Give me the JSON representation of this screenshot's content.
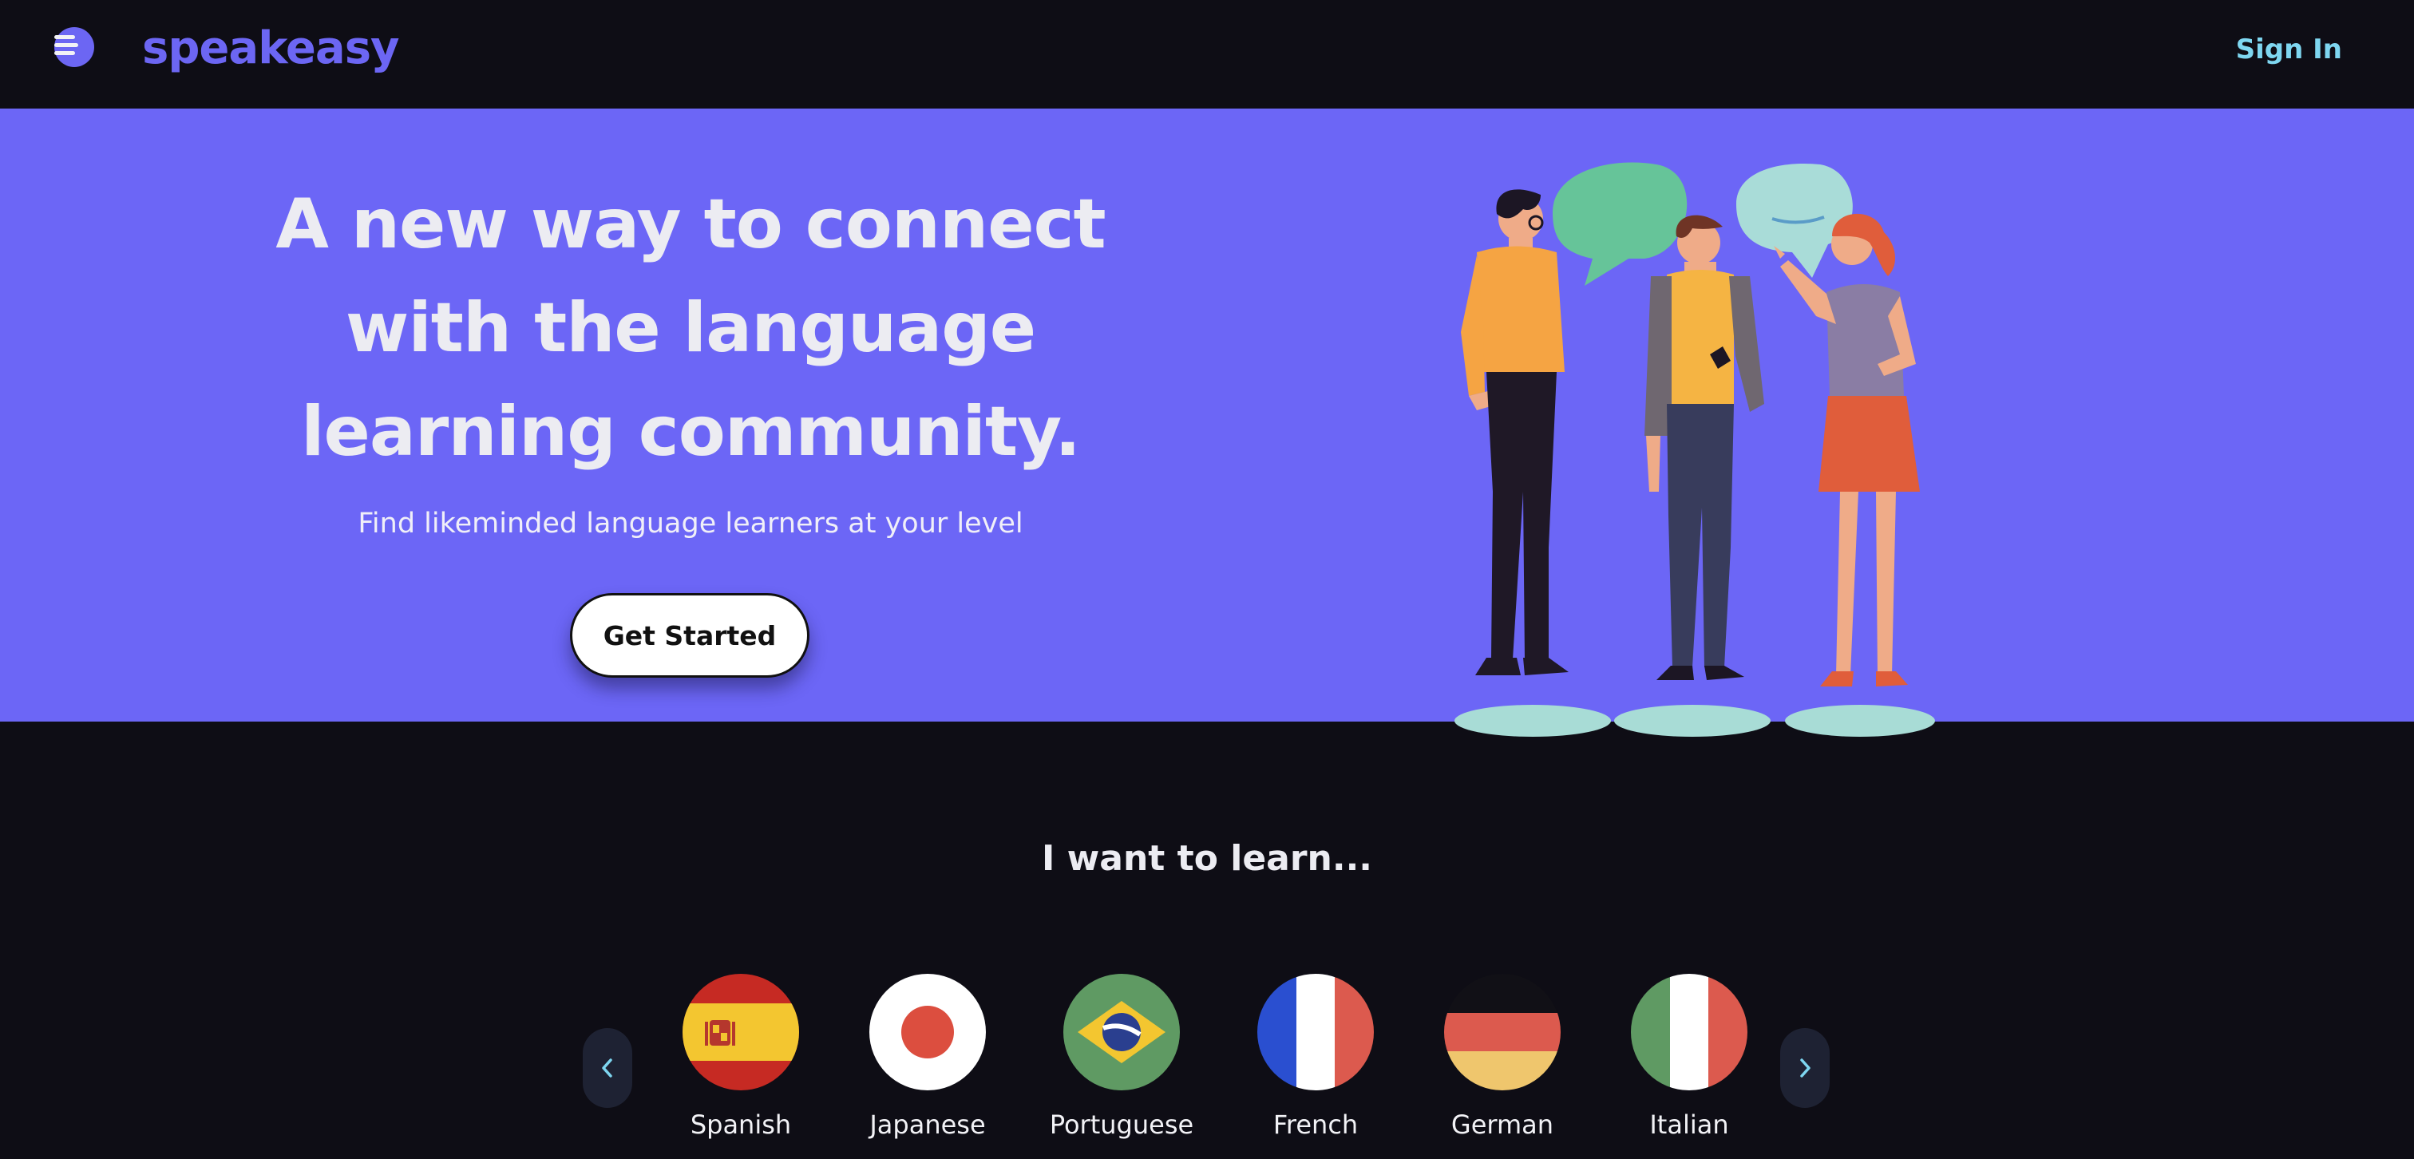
{
  "nav": {
    "brand": "speakeasy",
    "sign_in": "Sign In",
    "logo_icon": "speech-logo-icon"
  },
  "hero": {
    "headline_lines": [
      "A new way to connect",
      "with the language",
      "learning community."
    ],
    "subline": "Find likeminded language learners at your level",
    "cta": "Get Started",
    "illustration": "people-chatting-illustration"
  },
  "learn": {
    "title": "I want to learn...",
    "prev_icon": "chevron-left-icon",
    "next_icon": "chevron-right-icon",
    "languages": [
      {
        "label": "Spanish",
        "flag": "spain-flag-icon"
      },
      {
        "label": "Japanese",
        "flag": "japan-flag-icon"
      },
      {
        "label": "Portuguese",
        "flag": "brazil-flag-icon"
      },
      {
        "label": "French",
        "flag": "france-flag-icon"
      },
      {
        "label": "German",
        "flag": "germany-flag-icon"
      },
      {
        "label": "Italian",
        "flag": "italy-flag-icon"
      }
    ]
  },
  "colors": {
    "brand": "#6c66f3",
    "hero_bg": "#6c66f6",
    "page_bg": "#0e0d15",
    "sign_in": "#7ed6f0"
  }
}
